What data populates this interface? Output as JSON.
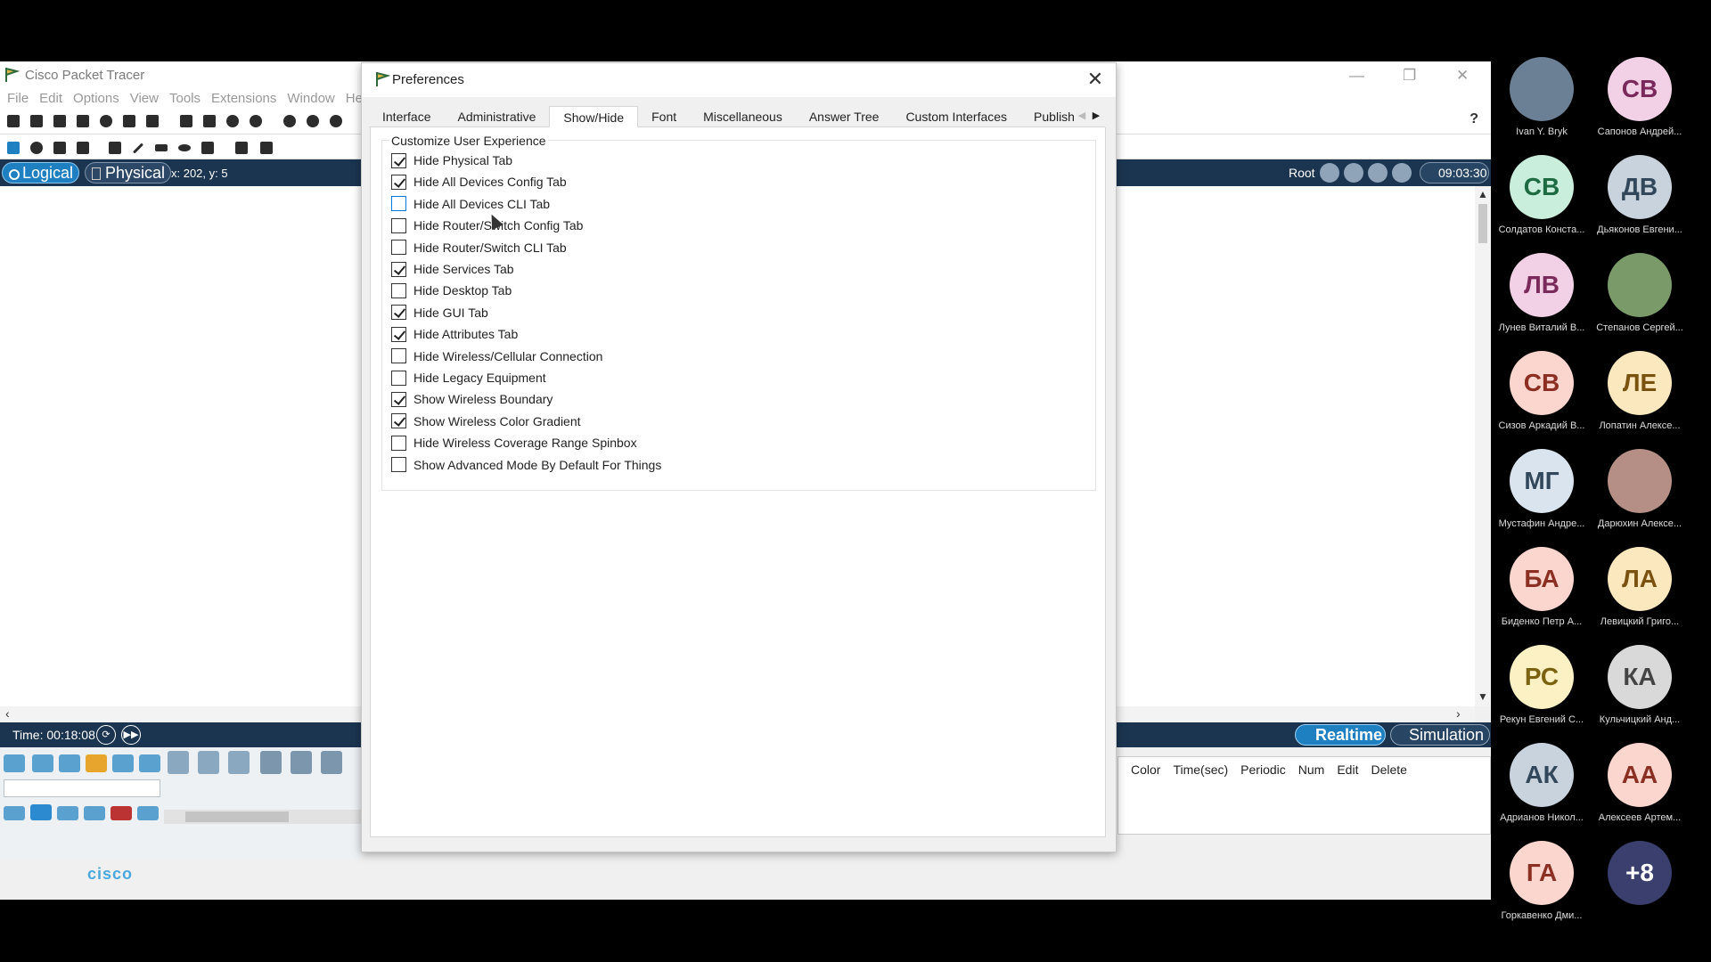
{
  "app": {
    "title": "Cisco Packet Tracer",
    "menus": [
      "File",
      "Edit",
      "Options",
      "View",
      "Tools",
      "Extensions",
      "Window",
      "Help"
    ],
    "help_label": "?",
    "mode": {
      "logical": "Logical",
      "physical": "Physical",
      "coords": "x: 202, y: 5",
      "root": "Root",
      "clock": "09:03:30"
    },
    "time": "Time: 00:18:08",
    "realtime": "Realtime",
    "simulation": "Simulation",
    "pdu_columns": [
      "Color",
      "Time(sec)",
      "Periodic",
      "Num",
      "Edit",
      "Delete"
    ],
    "brand": "cisco"
  },
  "dialog": {
    "title": "Preferences",
    "tabs": [
      "Interface",
      "Administrative",
      "Show/Hide",
      "Font",
      "Miscellaneous",
      "Answer Tree",
      "Custom Interfaces",
      "Publishe"
    ],
    "active_tab": "Show/Hide",
    "group_title": "Customize User Experience",
    "options": [
      {
        "label": "Hide Physical Tab",
        "checked": true
      },
      {
        "label": "Hide All Devices Config Tab",
        "checked": true
      },
      {
        "label": "Hide All Devices CLI Tab",
        "checked": false
      },
      {
        "label": "Hide Router/Switch Config Tab",
        "checked": false
      },
      {
        "label": "Hide Router/Switch CLI Tab",
        "checked": false
      },
      {
        "label": "Hide Services Tab",
        "checked": true
      },
      {
        "label": "Hide Desktop Tab",
        "checked": false
      },
      {
        "label": "Hide GUI Tab",
        "checked": true
      },
      {
        "label": "Hide Attributes Tab",
        "checked": true
      },
      {
        "label": "Hide Wireless/Cellular Connection",
        "checked": false
      },
      {
        "label": "Hide Legacy Equipment",
        "checked": false
      },
      {
        "label": "Show Wireless Boundary",
        "checked": true
      },
      {
        "label": "Show Wireless Color Gradient",
        "checked": true
      },
      {
        "label": "Hide Wireless Coverage Range Spinbox",
        "checked": false
      },
      {
        "label": "Show Advanced Mode By Default For Things",
        "checked": false
      }
    ]
  },
  "participants": [
    {
      "initials": "",
      "name": "Ivan Y. Bryk",
      "color": "#6b7f95",
      "text_color": "#ffffff",
      "photo": true
    },
    {
      "initials": "СВ",
      "name": "Сапонов Андрей...",
      "color": "#f2d0e6",
      "text_color": "#7a2a5a",
      "photo": false
    },
    {
      "initials": "СВ",
      "name": "Солдатов Конста...",
      "color": "#c9eedb",
      "text_color": "#1d6a43",
      "photo": false
    },
    {
      "initials": "ДВ",
      "name": "Дьяконов Евгени...",
      "color": "#c9d3de",
      "text_color": "#33475b",
      "photo": false
    },
    {
      "initials": "ЛВ",
      "name": "Лунев Виталий В...",
      "color": "#f2d0e6",
      "text_color": "#7a2a5a",
      "photo": false
    },
    {
      "initials": "",
      "name": "Степанов Сергей...",
      "color": "#7a9a6a",
      "text_color": "#ffffff",
      "photo": true
    },
    {
      "initials": "СВ",
      "name": "Сизов Аркадий В...",
      "color": "#fbd6cf",
      "text_color": "#8a2f22",
      "photo": false
    },
    {
      "initials": "ЛЕ",
      "name": "Лопатин Алексе...",
      "color": "#fbe8bf",
      "text_color": "#7a5210",
      "photo": false
    },
    {
      "initials": "МГ",
      "name": "Мустафин Андре...",
      "color": "#d9e4ef",
      "text_color": "#33475b",
      "photo": false
    },
    {
      "initials": "",
      "name": "Дарюхин Алексе...",
      "color": "#b58f86",
      "text_color": "#ffffff",
      "photo": true
    },
    {
      "initials": "БА",
      "name": "Биденко Петр А...",
      "color": "#fbd6cf",
      "text_color": "#8a2f22",
      "photo": false
    },
    {
      "initials": "ЛА",
      "name": "Левицкий Григо...",
      "color": "#fbe8bf",
      "text_color": "#7a5210",
      "photo": false
    },
    {
      "initials": "РС",
      "name": "Рекун Евгений С...",
      "color": "#fbf1c4",
      "text_color": "#7a6210",
      "photo": false
    },
    {
      "initials": "КА",
      "name": "Кульчицкий Анд...",
      "color": "#d9d9d9",
      "text_color": "#444444",
      "photo": false
    },
    {
      "initials": "АК",
      "name": "Адрианов Никол...",
      "color": "#c9d3de",
      "text_color": "#33475b",
      "photo": false
    },
    {
      "initials": "АА",
      "name": "Алексеев Артем...",
      "color": "#fbd6cf",
      "text_color": "#8a2f22",
      "photo": false
    },
    {
      "initials": "ГА",
      "name": "Горкавенко Дми...",
      "color": "#fbd6cf",
      "text_color": "#8a2f22",
      "photo": false
    },
    {
      "initials": "+8",
      "name": "",
      "color": "#3a3f6e",
      "text_color": "#ffffff",
      "photo": false
    }
  ]
}
